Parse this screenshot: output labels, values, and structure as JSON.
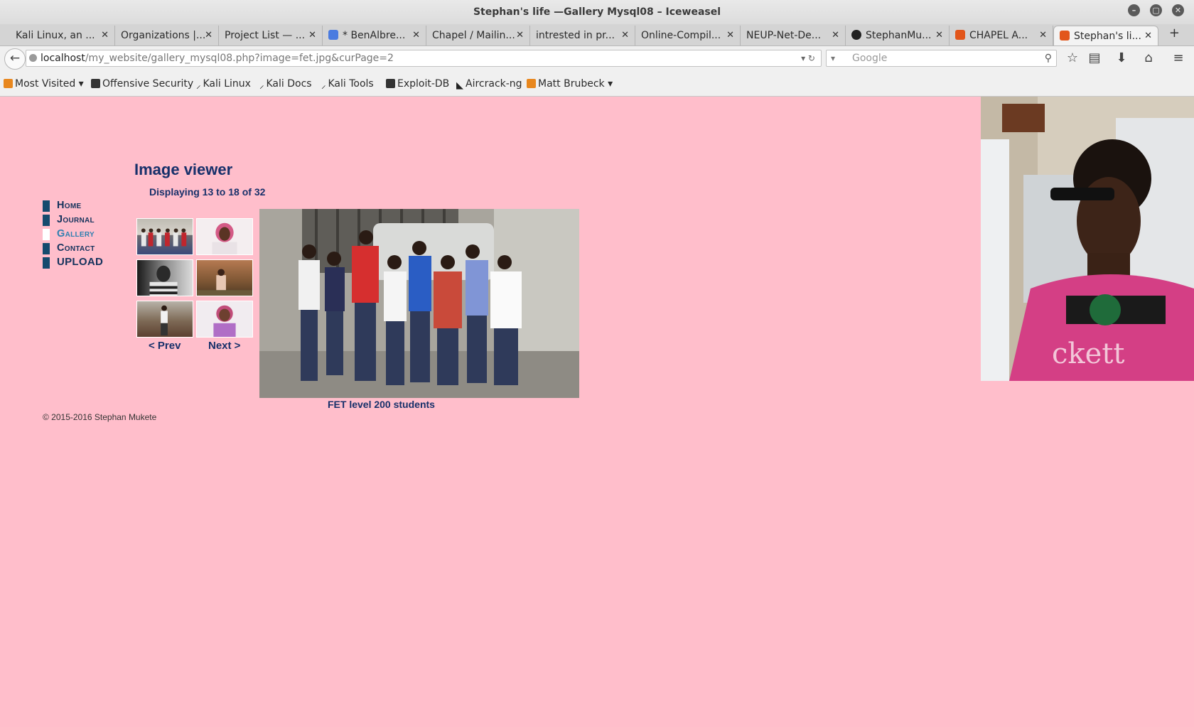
{
  "window": {
    "title": "Stephan's life —Gallery Mysql08 – Iceweasel",
    "minimize": "–",
    "maximize": "▢",
    "close": "✕"
  },
  "tabs": [
    {
      "label": "Kali Linux, an ...",
      "favicon": "none"
    },
    {
      "label": "Organizations |...",
      "favicon": "none"
    },
    {
      "label": "Project List — ...",
      "favicon": "none"
    },
    {
      "label": "* BenAlbre...",
      "favicon": "blue"
    },
    {
      "label": "Chapel / Mailin...",
      "favicon": "none"
    },
    {
      "label": "intrested in pr...",
      "favicon": "none"
    },
    {
      "label": "Online-Compil...",
      "favicon": "none"
    },
    {
      "label": "NEUP-Net-De...",
      "favicon": "none"
    },
    {
      "label": "StephanMu...",
      "favicon": "github"
    },
    {
      "label": "CHAPEL A...",
      "favicon": "orange"
    },
    {
      "label": "Stephan's li...",
      "favicon": "orange"
    }
  ],
  "tab_close": "✕",
  "new_tab": "+",
  "navbar": {
    "back": "←",
    "url_host": "localhost",
    "url_path": "/my_website/gallery_mysql08.php?image=fet.jpg&curPage=2",
    "url_controls": "▾ ↻",
    "search_placeholder": "Google",
    "search_engine": "▾",
    "search_icon": "⚲",
    "icons": {
      "bookmark": "☆",
      "reader": "▤",
      "download": "⬇",
      "home": "⌂",
      "menu": "≡"
    }
  },
  "bookmarks": [
    {
      "label": "Most Visited ▾",
      "icon": "orange"
    },
    {
      "label": "Offensive Security",
      "icon": "dark"
    },
    {
      "label": "Kali Linux",
      "icon": "dragon"
    },
    {
      "label": "Kali Docs",
      "icon": "dragon"
    },
    {
      "label": "Kali Tools",
      "icon": "dragon"
    },
    {
      "label": "Exploit-DB",
      "icon": "dark"
    },
    {
      "label": "Aircrack-ng",
      "icon": "dragon"
    },
    {
      "label": "Matt Brubeck ▾",
      "icon": "orange"
    }
  ],
  "page": {
    "menu": [
      {
        "label": "Home"
      },
      {
        "label": "Journal"
      },
      {
        "label": "Gallery"
      },
      {
        "label": "Contact"
      },
      {
        "label": "UPLOAD"
      }
    ],
    "title": "Image viewer",
    "display_count": "Displaying 13 to 18 of 32",
    "prev": "< Prev",
    "next": "Next >",
    "caption": "FET level 200 students",
    "footer": "© 2015-2016 Stephan Mukete"
  },
  "colors": {
    "page_bg": "#ffbecb",
    "nav_text": "#14325c",
    "nav_active": "#2e7fb0",
    "heading": "#17306a"
  }
}
